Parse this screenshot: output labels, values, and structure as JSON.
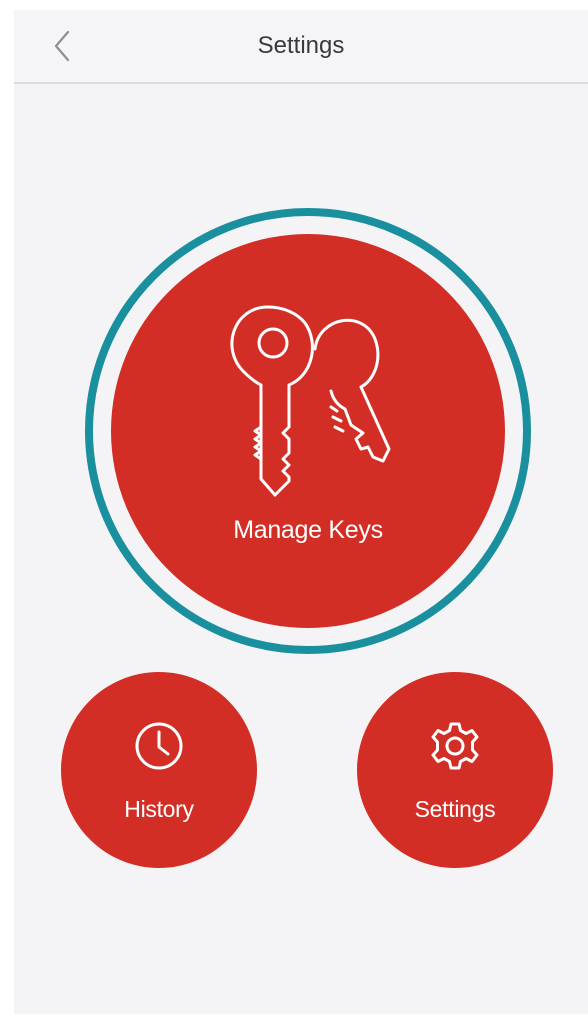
{
  "nav": {
    "title": "Settings",
    "back_icon": "chevron-left-icon"
  },
  "main_action": {
    "label": "Manage Keys",
    "icon": "keys-icon"
  },
  "secondary_actions": [
    {
      "label": "History",
      "icon": "clock-icon"
    },
    {
      "label": "Settings",
      "icon": "gear-icon"
    }
  ],
  "colors": {
    "button_red": "#d22e26",
    "ring_teal": "#1a8f9e",
    "background": "#f4f4f6",
    "nav_text": "#3a3a3c"
  }
}
